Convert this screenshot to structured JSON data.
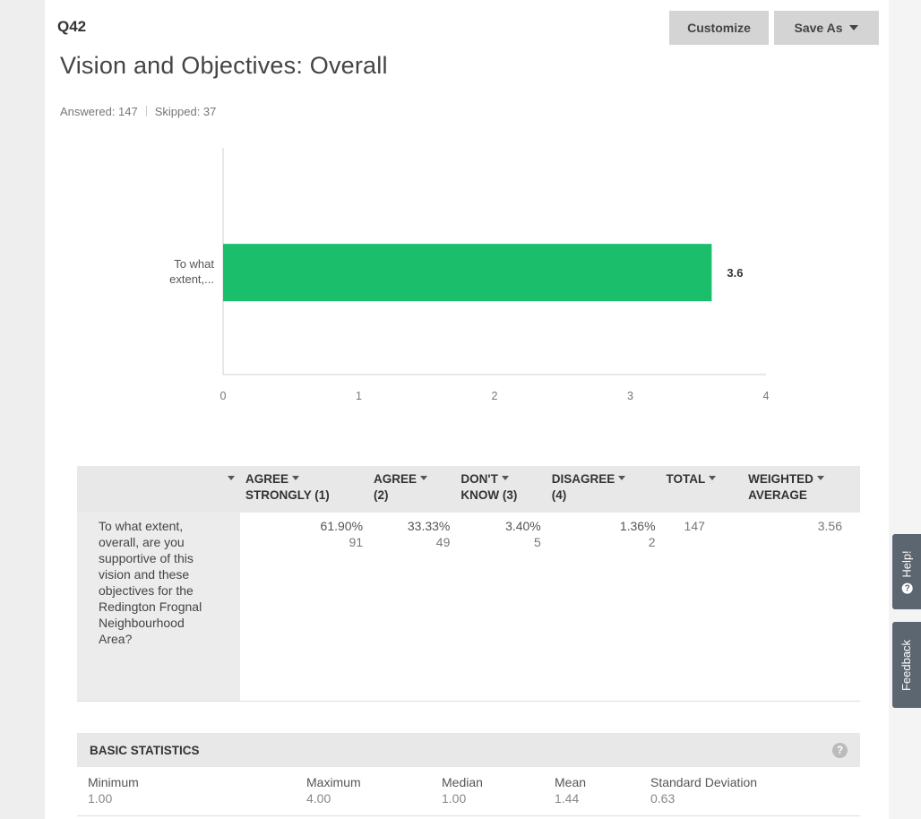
{
  "question": {
    "number": "Q42",
    "title": "Vision and Objectives: Overall",
    "answered": "Answered: 147",
    "skipped": "Skipped: 37"
  },
  "toolbar": {
    "customize_label": "Customize",
    "save_as_label": "Save As"
  },
  "chart_data": {
    "type": "bar",
    "orientation": "horizontal",
    "categories": [
      "To what extent,..."
    ],
    "category_label_lines": [
      "To what",
      "extent,..."
    ],
    "values": [
      3.6
    ],
    "data_labels": [
      "3.6"
    ],
    "xlim": [
      0,
      4
    ],
    "x_ticks": [
      "0",
      "1",
      "2",
      "3",
      "4"
    ],
    "bar_color": "#1bbf6b",
    "grid": false
  },
  "table": {
    "columns": [
      {
        "line1": "AGREE",
        "line2": "STRONGLY (1)"
      },
      {
        "line1": "AGREE",
        "line2": "(2)"
      },
      {
        "line1": "DON'T",
        "line2": "KNOW (3)"
      },
      {
        "line1": "DISAGREE",
        "line2": "(4)"
      },
      {
        "line1": "TOTAL",
        "line2": ""
      },
      {
        "line1": "WEIGHTED",
        "line2": "AVERAGE"
      }
    ],
    "row": {
      "label": "To what extent, overall, are you supportive of this vision and these objectives for the Redington Frognal Neighbourhood Area?",
      "cells": [
        {
          "pct": "61.90%",
          "count": "91"
        },
        {
          "pct": "33.33%",
          "count": "49"
        },
        {
          "pct": "3.40%",
          "count": "5"
        },
        {
          "pct": "1.36%",
          "count": "2"
        },
        {
          "pct": "",
          "count": "147"
        },
        {
          "pct": "",
          "count": "3.56"
        }
      ]
    }
  },
  "basic_statistics": {
    "title": "BASIC STATISTICS",
    "help_glyph": "?",
    "items": [
      {
        "label": "Minimum",
        "value": "1.00"
      },
      {
        "label": "Maximum",
        "value": "4.00"
      },
      {
        "label": "Median",
        "value": "1.00"
      },
      {
        "label": "Mean",
        "value": "1.44"
      },
      {
        "label": "Standard Deviation",
        "value": "0.63"
      }
    ]
  },
  "side_tabs": {
    "help_label": "Help!",
    "help_glyph": "?",
    "feedback_label": "Feedback"
  },
  "colors": {
    "accent": "#1bbf6b",
    "side_tab": "#5c6670"
  }
}
